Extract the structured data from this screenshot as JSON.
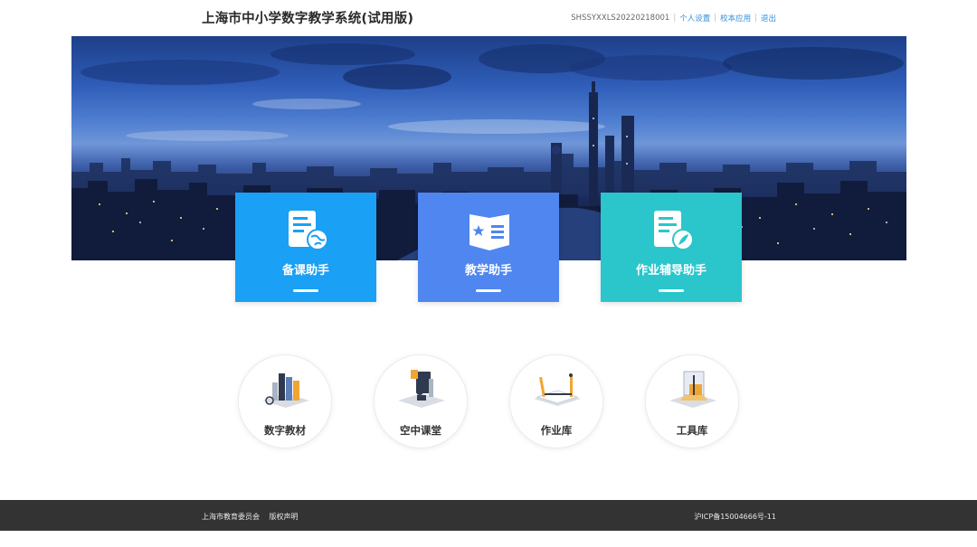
{
  "header": {
    "title": "上海市中小学数字教学系统(试用版)",
    "user_id": "SHSSYXXLS20220218001",
    "links": [
      "个人设置",
      "校本应用",
      "退出"
    ]
  },
  "banner": {
    "theme": "city-skyline-night"
  },
  "cards": [
    {
      "label": "备课助手",
      "color": "#1aa0f5",
      "icon": "lesson-prep-icon"
    },
    {
      "label": "教学助手",
      "color": "#4f86f0",
      "icon": "teaching-book-icon"
    },
    {
      "label": "作业辅导助手",
      "color": "#2bc5cc",
      "icon": "homework-tutor-icon"
    }
  ],
  "tools": [
    {
      "label": "数字教材",
      "icon": "digital-textbook-icon"
    },
    {
      "label": "空中课堂",
      "icon": "online-classroom-icon"
    },
    {
      "label": "作业库",
      "icon": "homework-library-icon"
    },
    {
      "label": "工具库",
      "icon": "toolbox-icon"
    }
  ],
  "footer": {
    "org": "上海市教育委员会",
    "copyright": "版权声明",
    "icp": "沪ICP备15004666号-11"
  }
}
